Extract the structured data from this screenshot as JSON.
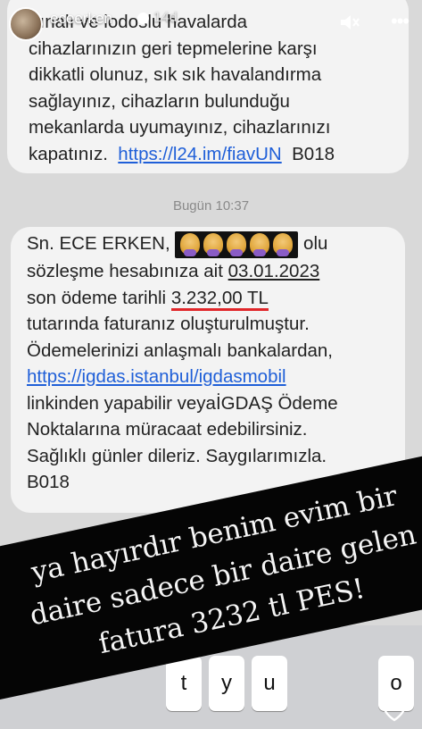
{
  "header": {
    "username": "eceerken",
    "time": "14d"
  },
  "messages": [
    {
      "lines": [
        "rtınalı ve lodoslu havalarda",
        "cihazlarınızın geri tepmelerine  karşı",
        "dikkatli olunuz, sık sık havalandırma",
        "sağlayınız, cihazların bulunduğu",
        "mekanlarda uyumayınız, cihazlarınızı"
      ],
      "last_prefix": "kapatınız.",
      "link": "https://l24.im/fiavUN",
      "last_suffix": "B018"
    },
    {
      "date": "Bugün 10:37",
      "greeting": "Sn. ECE ERKEN,",
      "greeting_tail": "olu",
      "line2_prefix": "sözleşme hesabınıza ait",
      "due_date": "03.01.2023",
      "line3_prefix": "son ödeme tarihli",
      "amount": "3.232,00 TL",
      "lines_after": [
        "tutarında faturanız oluşturulmuştur.",
        "Ödemelerinizi anlaşmalı bankalardan,"
      ],
      "link": "https://igdas.istanbul/igdasmobil",
      "lines_tail": [
        "linkinden yapabilir veyaİGDAŞ Ödeme",
        "Noktalarına müracaat edebilirsiniz.",
        "Sağlıklı günler dileriz. Saygılarımızla.",
        "B018"
      ]
    }
  ],
  "caption": {
    "line1": "ya hayırdır benim evim bir",
    "line2": "daire sadece bir daire gelen",
    "line3": "fatura 3232 tl PES!"
  },
  "keyboard": {
    "keys": [
      "t",
      "y",
      "u",
      "o"
    ]
  },
  "colors": {
    "link": "#1f5fd8",
    "underline": "#e0262a",
    "bubble": "#f3f3f3",
    "caption_bg": "#050505"
  }
}
